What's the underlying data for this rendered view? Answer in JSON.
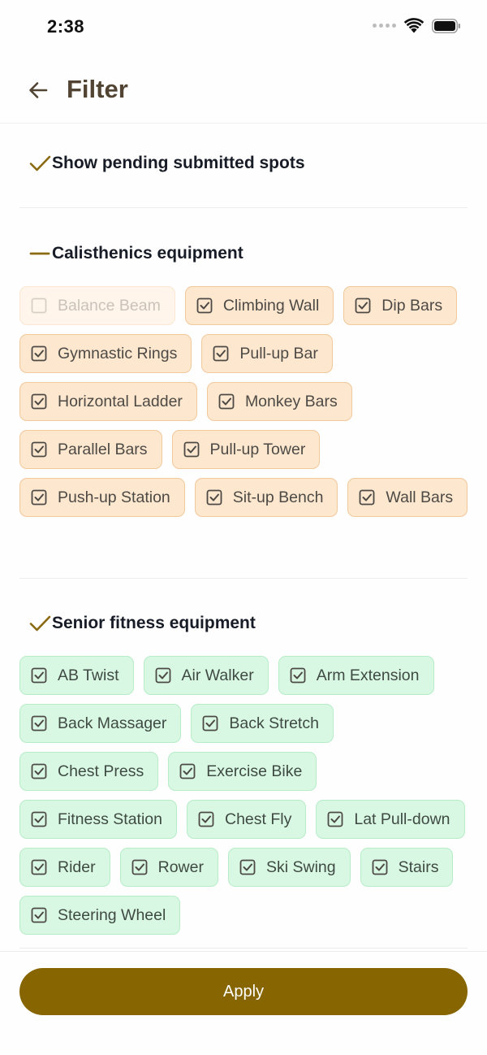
{
  "status_bar": {
    "time": "2:38"
  },
  "header": {
    "title": "Filter"
  },
  "pending": {
    "label": "Show pending submitted spots",
    "checked": true
  },
  "calisthenics": {
    "label": "Calisthenics equipment",
    "state": "partial",
    "items": [
      {
        "label": "Balance Beam",
        "checked": false
      },
      {
        "label": "Climbing Wall",
        "checked": true
      },
      {
        "label": "Dip Bars",
        "checked": true
      },
      {
        "label": "Gymnastic Rings",
        "checked": true
      },
      {
        "label": "Pull-up Bar",
        "checked": true
      },
      {
        "label": "Horizontal Ladder",
        "checked": true
      },
      {
        "label": "Monkey Bars",
        "checked": true
      },
      {
        "label": "Parallel Bars",
        "checked": true
      },
      {
        "label": "Pull-up Tower",
        "checked": true
      },
      {
        "label": "Push-up Station",
        "checked": true
      },
      {
        "label": "Sit-up Bench",
        "checked": true
      },
      {
        "label": "Wall Bars",
        "checked": true
      }
    ]
  },
  "senior": {
    "label": "Senior fitness equipment",
    "state": "all",
    "items": [
      {
        "label": "AB Twist",
        "checked": true
      },
      {
        "label": "Air Walker",
        "checked": true
      },
      {
        "label": "Arm Extension",
        "checked": true
      },
      {
        "label": "Back Massager",
        "checked": true
      },
      {
        "label": "Back Stretch",
        "checked": true
      },
      {
        "label": "Chest Press",
        "checked": true
      },
      {
        "label": "Exercise Bike",
        "checked": true
      },
      {
        "label": "Fitness Station",
        "checked": true
      },
      {
        "label": "Chest Fly",
        "checked": true
      },
      {
        "label": "Lat Pull-down",
        "checked": true
      },
      {
        "label": "Rider",
        "checked": true
      },
      {
        "label": "Rower",
        "checked": true
      },
      {
        "label": "Ski Swing",
        "checked": true
      },
      {
        "label": "Stairs",
        "checked": true
      },
      {
        "label": "Steering Wheel",
        "checked": true
      }
    ]
  },
  "apply_label": "Apply",
  "colors": {
    "accent": "#876500",
    "title": "#514432",
    "check_mark": "#8a6a12",
    "calisthenics_chip_bg": "#fde7cf",
    "senior_chip_bg": "#d9f8e3"
  }
}
